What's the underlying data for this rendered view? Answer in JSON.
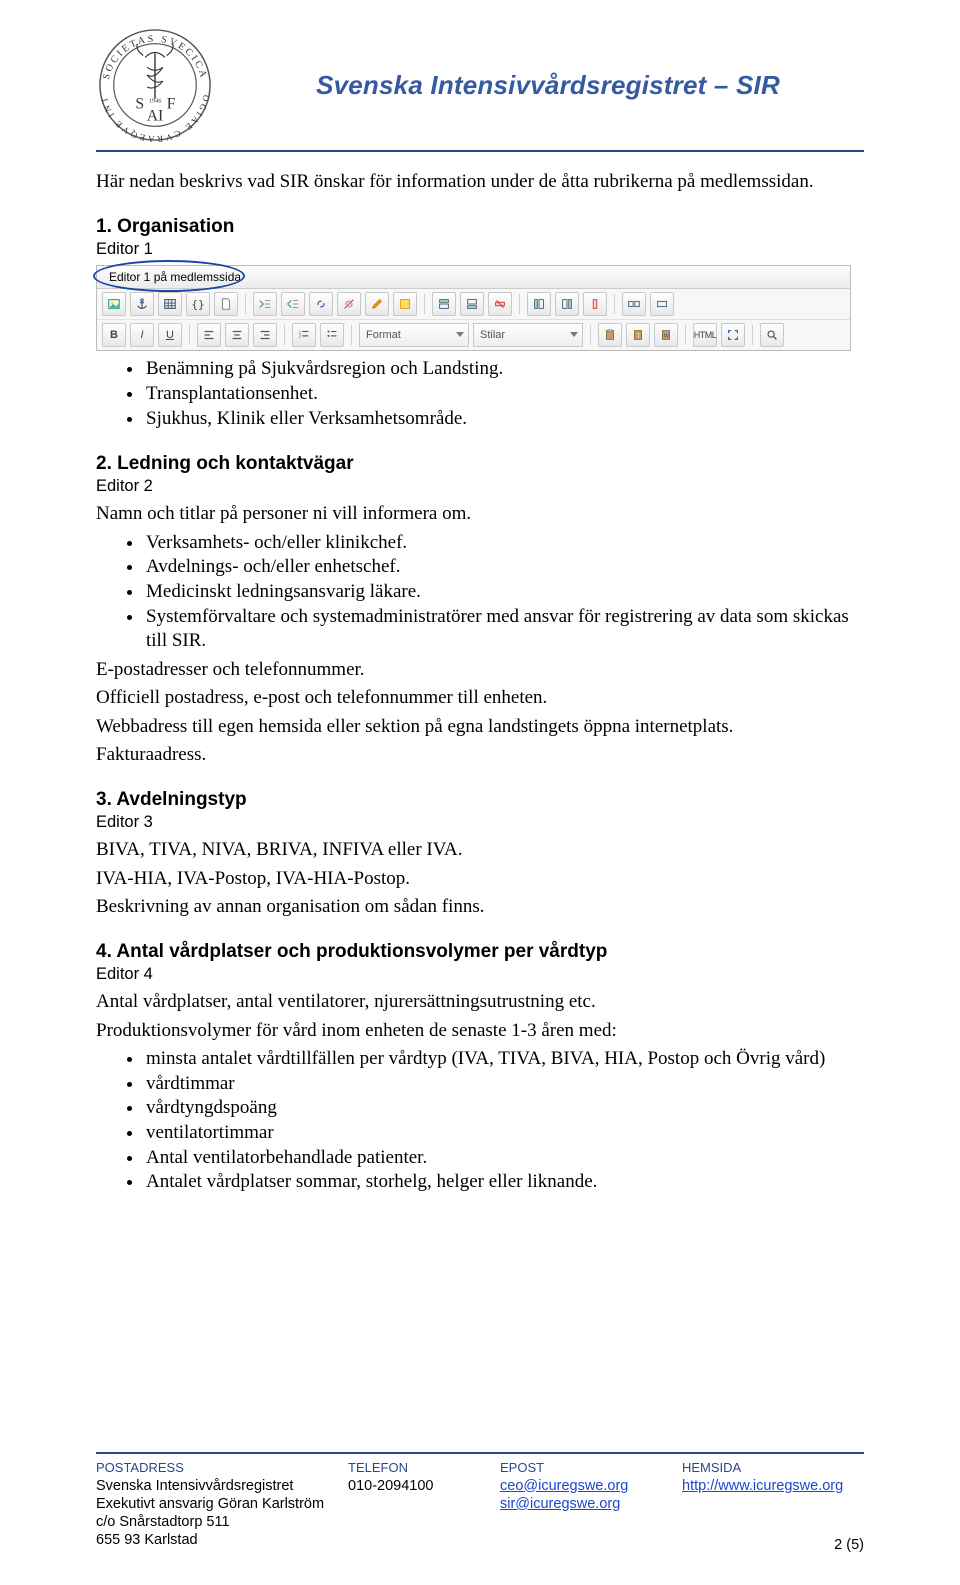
{
  "header": {
    "title": "Svenska Intensivvårdsregistret – SIR",
    "seal": {
      "top": "SOCIETAS SVECICA",
      "bottom": "OGIAE CVRAEQVE INT",
      "initials_left": "S",
      "initials_right": "F",
      "center": "AI",
      "year": "1946"
    }
  },
  "intro": "Här nedan beskrivs vad SIR önskar för information under de åtta rubrikerna på medlemssidan.",
  "sections": {
    "s1": {
      "heading": "1. Organisation",
      "editor": "Editor 1",
      "bullets": [
        "Benämning på Sjukvårdsregion och Landsting.",
        "Transplantationsenhet.",
        "Sjukhus, Klinik eller Verksamhetsområde."
      ]
    },
    "s2": {
      "heading": "2. Ledning och kontaktvägar",
      "editor": "Editor 2",
      "lead": "Namn och titlar på personer ni vill informera om.",
      "bullets": [
        "Verksamhets- och/eller klinikchef.",
        "Avdelnings- och/eller enhetschef.",
        "Medicinskt ledningsansvarig läkare.",
        "Systemförvaltare och systemadministratörer med ansvar för registrering av data som skickas till SIR."
      ],
      "tail": [
        "E-postadresser och telefonnummer.",
        "Officiell postadress, e-post och telefonnummer till enheten.",
        "Webbadress till egen hemsida eller sektion på egna landstingets öppna internetplats.",
        "Fakturaadress."
      ]
    },
    "s3": {
      "heading": "3. Avdelningstyp",
      "editor": "Editor 3",
      "lines": [
        "BIVA, TIVA, NIVA, BRIVA, INFIVA eller IVA.",
        "IVA-HIA, IVA-Postop, IVA-HIA-Postop.",
        "Beskrivning av annan organisation om sådan finns."
      ]
    },
    "s4": {
      "heading": "4. Antal vårdplatser och produktionsvolymer per vårdtyp",
      "editor": "Editor 4",
      "lead1": "Antal vårdplatser, antal ventilatorer, njurersättningsutrustning etc.",
      "lead2": "Produktionsvolymer för vård inom enheten de senaste 1-3 åren med:",
      "bullets": [
        "minsta antalet vårdtillfällen per vårdtyp (IVA, TIVA, BIVA, HIA, Postop och Övrig vård)",
        "vårdtimmar",
        "vårdtyngdspoäng",
        "ventilatortimmar",
        "Antal ventilatorbehandlade patienter.",
        "Antalet vårdplatser sommar, storhelg, helger eller liknande."
      ]
    }
  },
  "editor_toolbar": {
    "tab_label": "Editor 1 på medlemssida",
    "dd_format": "Format",
    "dd_style": "Stilar",
    "html_label": "HTML"
  },
  "footer": {
    "col1": {
      "head": "POSTADRESS",
      "l1": "Svenska Intensivvårdsregistret",
      "l2": "Exekutivt ansvarig Göran Karlström",
      "l3": "c/o Snårstadtorp 511",
      "l4": "655 93  Karlstad"
    },
    "col2": {
      "head": "TELEFON",
      "l1": "010-2094100"
    },
    "col3": {
      "head": "EPOST",
      "l1": "ceo@icuregswe.org",
      "l2": "sir@icuregswe.org"
    },
    "col4": {
      "head": "HEMSIDA",
      "l1": "http://www.icuregswe.org"
    },
    "pagenum": "2 (5)"
  }
}
